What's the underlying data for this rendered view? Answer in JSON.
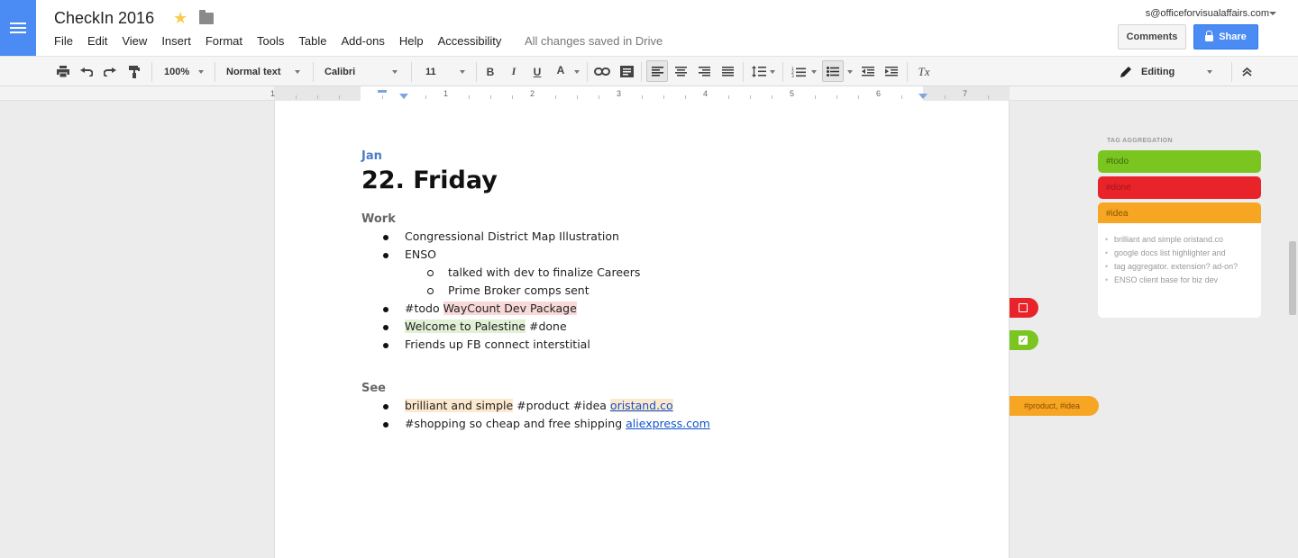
{
  "app": {
    "title": "CheckIn 2016",
    "menu": [
      "File",
      "Edit",
      "View",
      "Insert",
      "Format",
      "Tools",
      "Table",
      "Add-ons",
      "Help",
      "Accessibility"
    ],
    "save_status": "All changes saved in Drive",
    "account": "s@officeforvisualaffairs.com",
    "comments_label": "Comments",
    "share_label": "Share"
  },
  "toolbar": {
    "zoom": "100%",
    "style": "Normal text",
    "font": "Calibri",
    "size": "11",
    "mode": "Editing",
    "bold": "B",
    "italic": "I",
    "underline": "U",
    "font_color": "A",
    "clear_format": "Tx"
  },
  "ruler": {
    "numbers": [
      "1",
      "1",
      "2",
      "3",
      "4",
      "5",
      "6",
      "7"
    ]
  },
  "doc": {
    "month": "Jan",
    "heading": "22. Friday",
    "sections": {
      "work": "Work",
      "see": "See"
    },
    "work_items": {
      "i1": "Congressional District Map Illustration",
      "i2": "ENSO",
      "i2a": "talked with dev to finalize Careers",
      "i2b": "Prime Broker comps sent",
      "i3_tag": "#todo",
      "i3_text": "WayCount Dev Package",
      "i4_text": "Welcome to Palestine",
      "i4_tag": "#done",
      "i5": "Friends up FB connect interstitial"
    },
    "see_items": {
      "s1_text": "brilliant and simple",
      "s1_tags": "#product #idea",
      "s1_link": "oristand.co",
      "s2_text": "#shopping so cheap and free shipping",
      "s2_link": "aliexpress.com"
    }
  },
  "markers": {
    "tag_text": "#product, #idea"
  },
  "tag_panel": {
    "title": "TAG AGGREGATION",
    "tags": [
      "#todo",
      "#done",
      "#idea"
    ],
    "items": [
      "brilliant and simple oristand.co",
      "google docs list highlighter and",
      "tag aggregator. extension? ad-on?",
      "ENSO client base for biz dev"
    ]
  },
  "colors": {
    "accent": "#4b8bf4",
    "todo": "#7ac520",
    "done": "#e8232a",
    "idea": "#f6a623",
    "month": "#4a7cc5"
  }
}
